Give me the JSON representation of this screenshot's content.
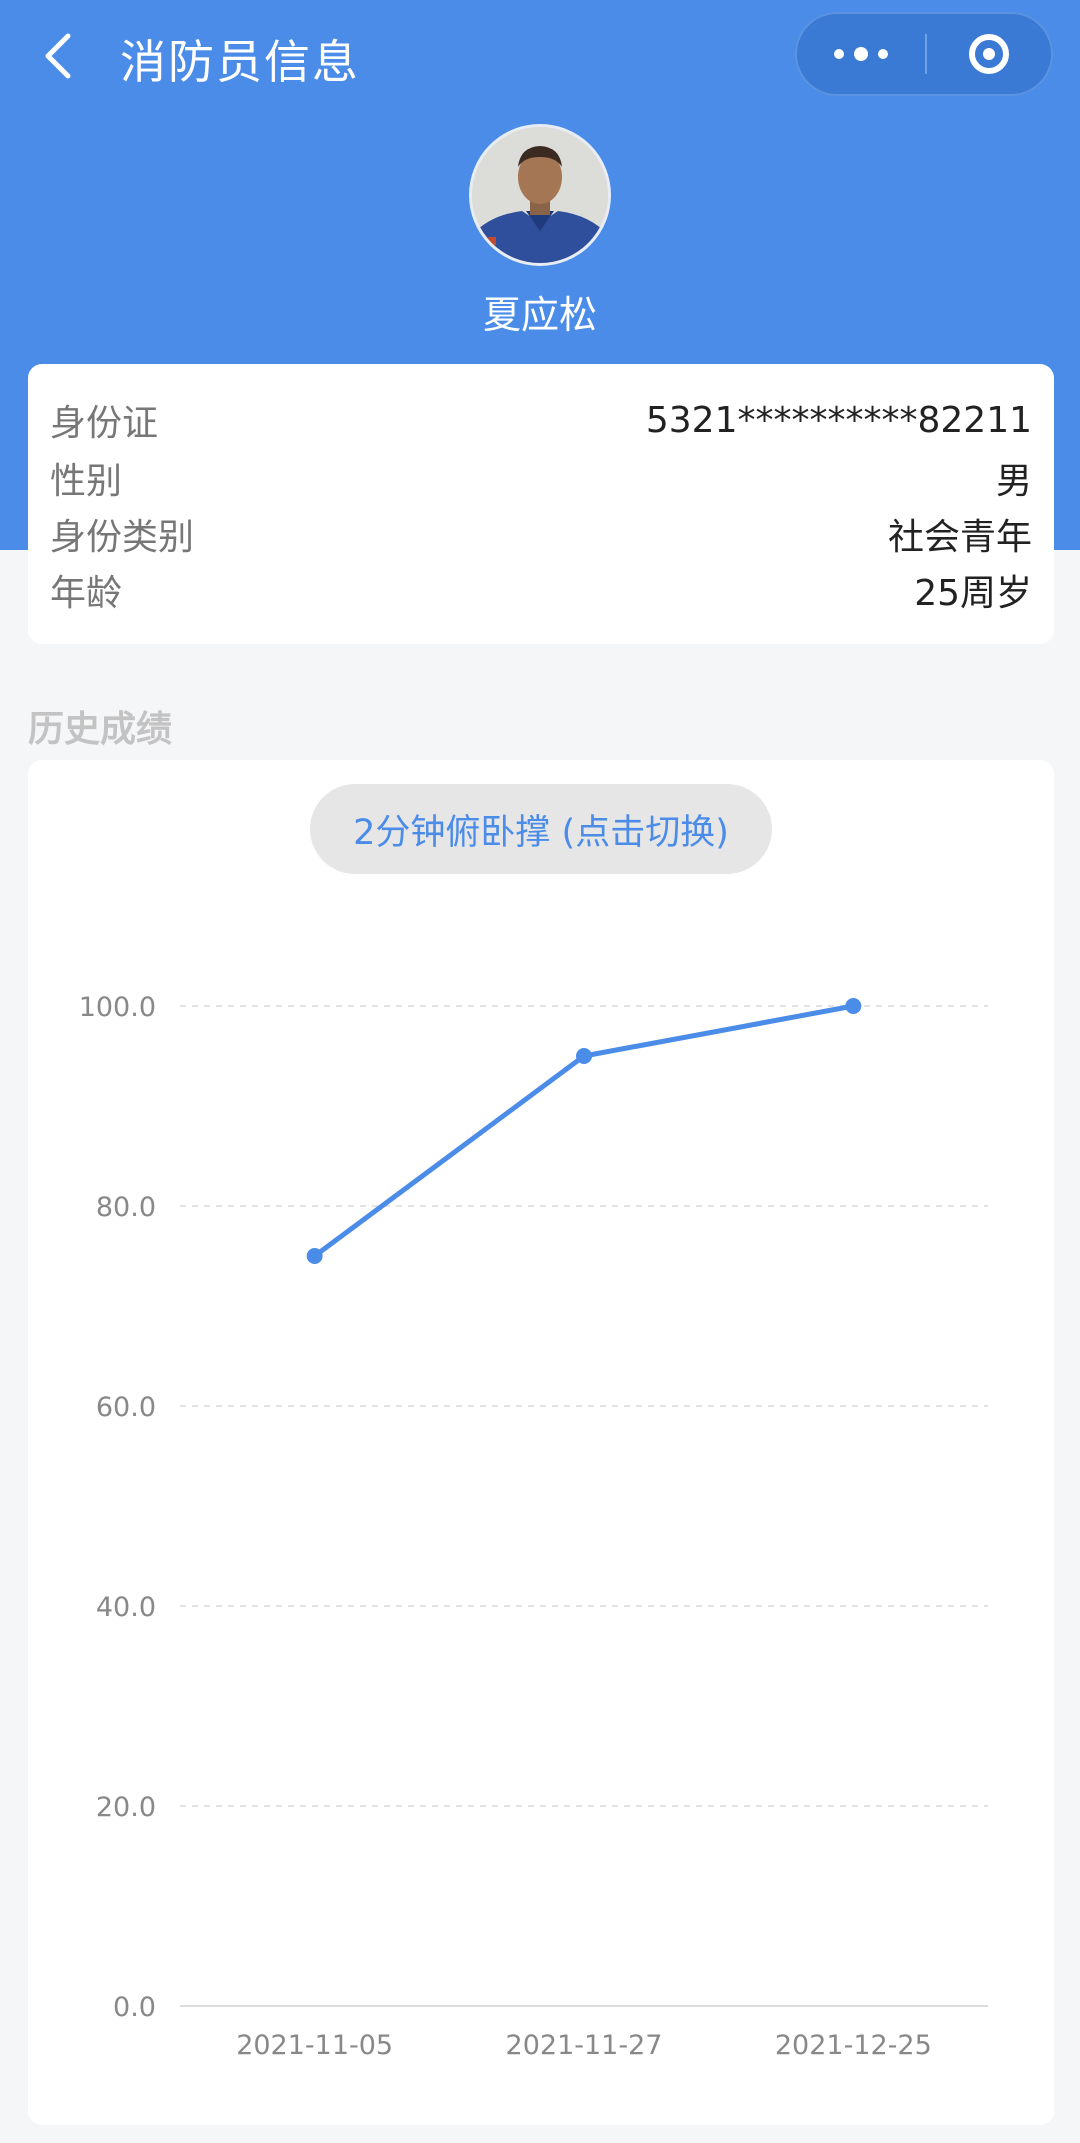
{
  "header": {
    "title": "消防员信息"
  },
  "profile": {
    "name": "夏应松"
  },
  "info": {
    "rows": [
      {
        "key": "身份证",
        "value": "5321**********82211"
      },
      {
        "key": "性别",
        "value": "男"
      },
      {
        "key": "身份类别",
        "value": "社会青年"
      },
      {
        "key": "年龄",
        "value": "25周岁"
      }
    ]
  },
  "history": {
    "section_title": "历史成绩",
    "switch_label": "2分钟俯卧撑 (点击切换)"
  },
  "colors": {
    "header_blue": "#4a8ce8",
    "line_blue": "#4a8ce8"
  },
  "icons": {
    "back": "chevron-left-icon",
    "more": "more-dots-icon",
    "close": "target-circle-icon"
  },
  "chart_data": {
    "type": "line",
    "x": [
      "2021-11-05",
      "2021-11-27",
      "2021-12-25"
    ],
    "series": [
      {
        "values": [
          75,
          95,
          100
        ]
      }
    ],
    "yticks": [
      "0.0",
      "20.0",
      "40.0",
      "60.0",
      "80.0",
      "100.0"
    ],
    "ylim": [
      0,
      100
    ],
    "grid": true
  }
}
